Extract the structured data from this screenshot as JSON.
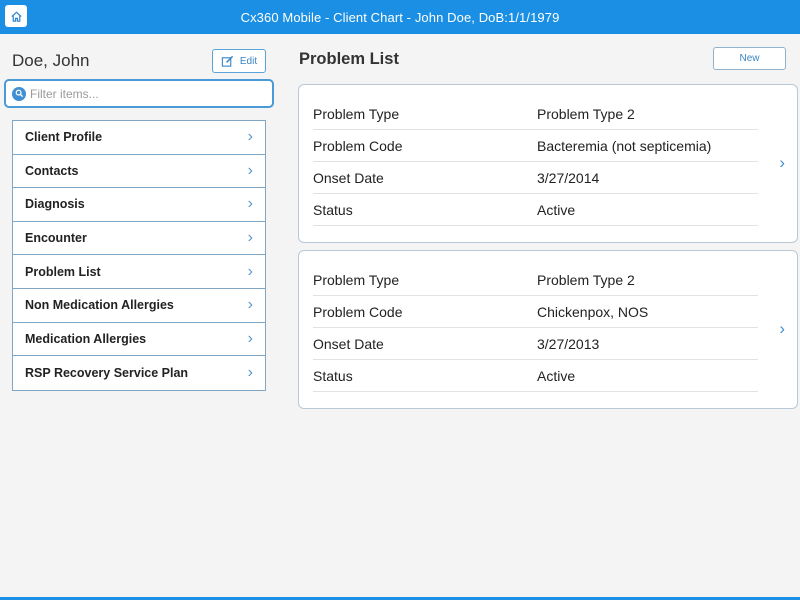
{
  "header": {
    "title": "Cx360 Mobile - Client Chart - John Doe, DoB:1/1/1979"
  },
  "client": {
    "name": "Doe, John",
    "edit_label": "Edit"
  },
  "filter": {
    "placeholder": "Filter items...",
    "value": ""
  },
  "sidebar": {
    "items": [
      {
        "label": "Client Profile"
      },
      {
        "label": "Contacts"
      },
      {
        "label": "Diagnosis"
      },
      {
        "label": "Encounter"
      },
      {
        "label": "Problem List"
      },
      {
        "label": "Non Medication Allergies"
      },
      {
        "label": "Medication Allergies"
      },
      {
        "label": "RSP Recovery Service Plan"
      }
    ]
  },
  "main": {
    "title": "Problem List",
    "new_label": "New",
    "problems": [
      {
        "fields": [
          {
            "label": "Problem Type",
            "value": "Problem Type 2"
          },
          {
            "label": "Problem Code",
            "value": "Bacteremia (not septicemia)"
          },
          {
            "label": "Onset Date",
            "value": "3/27/2014"
          },
          {
            "label": "Status",
            "value": "Active"
          }
        ]
      },
      {
        "fields": [
          {
            "label": "Problem Type",
            "value": "Problem Type 2"
          },
          {
            "label": "Problem Code",
            "value": "Chickenpox, NOS"
          },
          {
            "label": "Onset Date",
            "value": "3/27/2013"
          },
          {
            "label": "Status",
            "value": "Active"
          }
        ]
      }
    ]
  },
  "colors": {
    "header": "#1a8fe3",
    "accent": "#3f8fd4"
  }
}
